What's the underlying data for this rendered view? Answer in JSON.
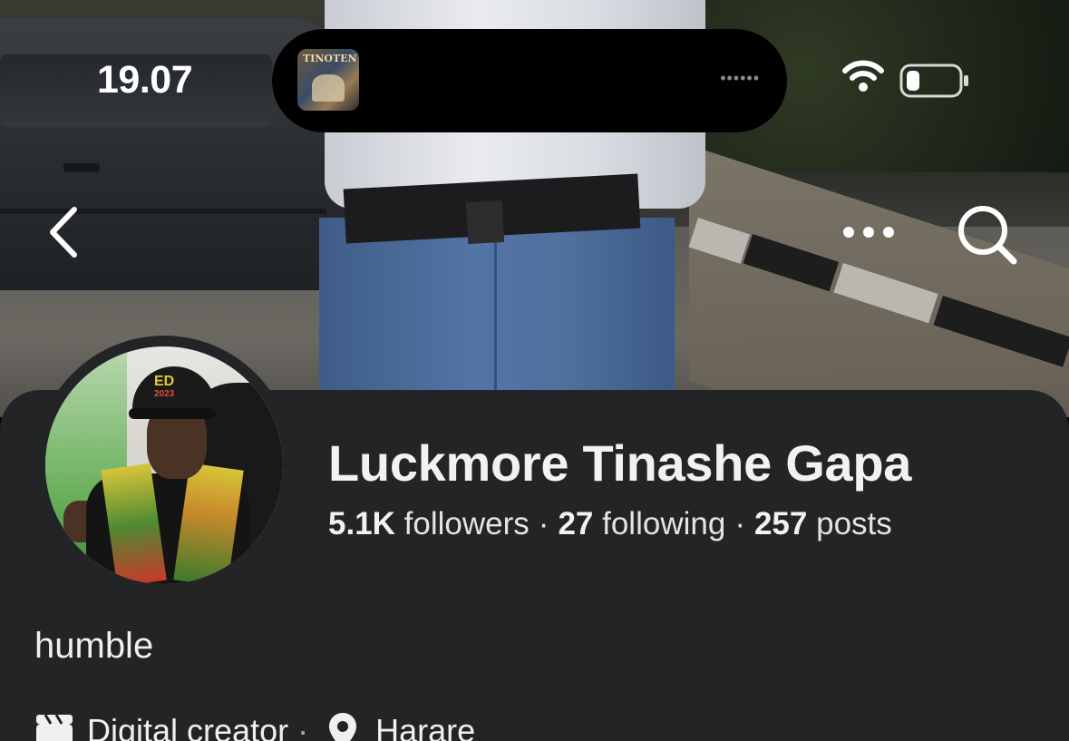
{
  "status_bar": {
    "time": "19.07",
    "dynamic_island": {
      "media_dots": "••••••",
      "artwork_title": "TINOTEN"
    },
    "icons": [
      "wifi-icon",
      "battery-icon"
    ]
  },
  "nav": {
    "icons": [
      "back-icon",
      "more-icon",
      "search-icon"
    ]
  },
  "profile": {
    "name": "Luckmore Tinashe Gapa",
    "stats": {
      "followers_count": "5.1K",
      "followers_label": "followers",
      "following_count": "27",
      "following_label": "following",
      "posts_count": "257",
      "posts_label": "posts",
      "separator": "·"
    },
    "bio": "humble",
    "category": "Digital creator",
    "location": "Harare",
    "meta_separator": "·",
    "avatar_cap_text": "ED",
    "avatar_cap_year": "2023"
  },
  "colors": {
    "card_bg": "#232426",
    "text_primary": "#f2f2f4"
  }
}
